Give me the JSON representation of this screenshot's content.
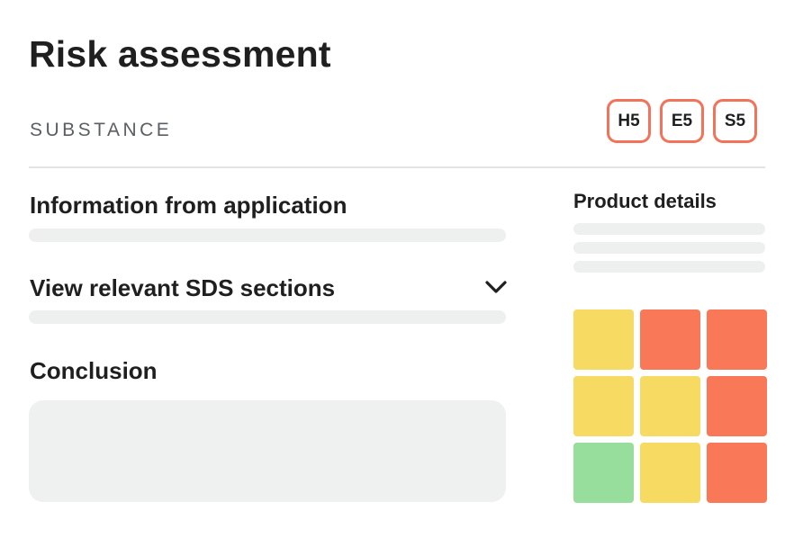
{
  "header": {
    "title": "Risk assessment",
    "section_label": "SUBSTANCE"
  },
  "badges": [
    {
      "label": "H5"
    },
    {
      "label": "E5"
    },
    {
      "label": "S5"
    }
  ],
  "badge_border_color": "#f2735a",
  "main": {
    "information_title": "Information from application",
    "sds_title": "View relevant SDS sections",
    "sds_toggle_icon": "chevron-down-icon",
    "conclusion_title": "Conclusion"
  },
  "product": {
    "title": "Product details",
    "risk_matrix": {
      "colors": {
        "yellow": "#f7da62",
        "orange": "#f97857",
        "green": "#97dd9c"
      },
      "cells": [
        [
          "yellow",
          "orange",
          "orange"
        ],
        [
          "yellow",
          "yellow",
          "orange"
        ],
        [
          "green",
          "yellow",
          "orange"
        ]
      ]
    }
  }
}
